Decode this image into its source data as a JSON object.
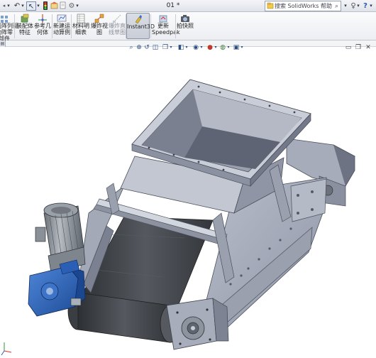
{
  "titlebar": {
    "document_title": "01 *",
    "search_placeholder": "搜索 SolidWorks 帮助",
    "icons": [
      "back-arrow-icon",
      "undo-icon",
      "select-pointer-icon",
      "traffic-light-icon",
      "rebuild-icon",
      "file-properties-icon",
      "options-gear-icon",
      "help-icon",
      "lightbulb-icon"
    ]
  },
  "ribbon": {
    "buttons": [
      {
        "icon": "component-pattern-icon",
        "line1": "线阵列驱",
        "line2": "动阵零",
        "line3": "部件",
        "active": false,
        "dim": false
      },
      {
        "icon": "assembly-feature-icon",
        "line1": "装配体",
        "line2": "特征",
        "line3": "",
        "active": false,
        "dim": false
      },
      {
        "icon": "reference-geometry-icon",
        "line1": "参考几",
        "line2": "何体",
        "line3": "",
        "active": false,
        "dim": false
      },
      {
        "icon": "new-motion-study-icon",
        "line1": "新建运",
        "line2": "动算例",
        "line3": "",
        "active": false,
        "dim": false
      },
      {
        "icon": "bill-of-materials-icon",
        "line1": "材料明",
        "line2": "细表",
        "line3": "",
        "active": false,
        "dim": false
      },
      {
        "icon": "exploded-view-icon",
        "line1": "爆炸视",
        "line2": "图",
        "line3": "",
        "active": false,
        "dim": false
      },
      {
        "icon": "explode-line-sketch-icon",
        "line1": "爆炸直",
        "line2": "线草图",
        "line3": "",
        "active": false,
        "dim": true
      },
      {
        "icon": "instant3d-icon",
        "line1": "Instant3D",
        "line2": "",
        "line3": "",
        "active": true,
        "dim": false
      },
      {
        "icon": "update-speedpak-icon",
        "line1": "更新",
        "line2": "Speedpak",
        "line3": "",
        "active": false,
        "dim": false
      },
      {
        "icon": "take-snapshot-icon",
        "line1": "拍快照",
        "line2": "",
        "line3": "",
        "active": false,
        "dim": false
      }
    ]
  },
  "hud": {
    "icons": [
      "zoom-to-fit-icon",
      "zoom-to-area-icon",
      "previous-view-icon",
      "section-view-icon",
      "view-orientation-icon",
      "display-style-icon",
      "hide-show-items-icon",
      "edit-appearance-icon",
      "apply-scene-icon",
      "view-settings-icon"
    ],
    "window_controls": [
      "minimize-icon",
      "restore-icon",
      "close-icon"
    ]
  },
  "colors": {
    "steel": "#9da3b4",
    "steel_light": "#c5cad6",
    "steel_dark": "#6f7585",
    "belt": "#3c3f44",
    "motor_blue": "#2c63b8",
    "motor_grey": "#8e949c"
  }
}
